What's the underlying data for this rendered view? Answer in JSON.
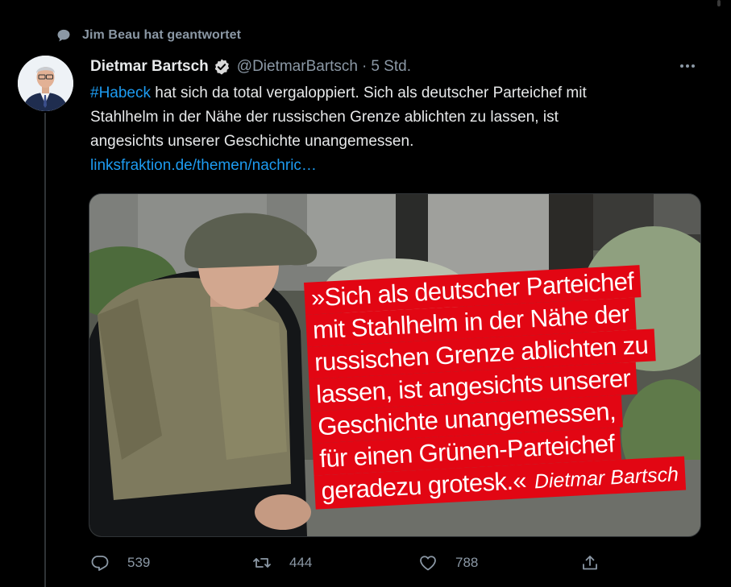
{
  "context": {
    "replied_label": "Jim Beau hat geantwortet"
  },
  "tweet": {
    "author_name": "Dietmar Bartsch",
    "handle": "@DietmarBartsch",
    "separator": "·",
    "time": "5 Std.",
    "hashtag": "#Habeck",
    "text_line1_rest": " hat sich da total vergaloppiert. Sich als deutscher Parteichef mit",
    "text_line2": "Stahlhelm in der Nähe der russischen Grenze ablichten zu lassen, ist",
    "text_line3": "angesichts unserer Geschichte unangemessen.",
    "link": "linksfraktion.de/themen/nachric…"
  },
  "media": {
    "quote_lines": [
      "»Sich als deutscher Parteichef",
      "mit Stahlhelm in der Nähe der",
      "russischen Grenze ablichten zu",
      "lassen, ist angesichts unserer",
      "Geschichte unangemessen,",
      "für einen Grünen-Parteichef",
      "geradezu grotesk.«"
    ],
    "quote_signature": "Dietmar Bartsch",
    "quote_bg_color": "#e20613"
  },
  "actions": {
    "reply_count": "539",
    "retweet_count": "444",
    "like_count": "788",
    "reply_icon": "reply-icon",
    "retweet_icon": "retweet-icon",
    "like_icon": "heart-icon",
    "share_icon": "share-icon"
  },
  "colors": {
    "background": "#000000",
    "link": "#1d9bf0",
    "muted": "#8b98a5"
  }
}
